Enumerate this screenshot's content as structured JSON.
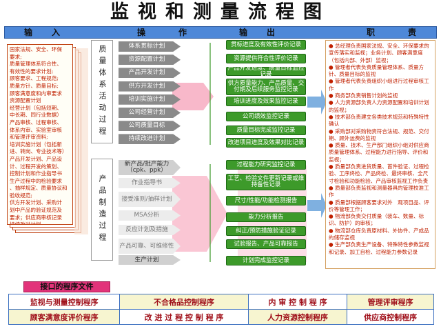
{
  "title": "监视和测量流程图",
  "headers": {
    "input": "输　入",
    "operate": "操　　作",
    "output": "输　出",
    "duty": "职　　责"
  },
  "inputs": [
    "国家法规、安全、环保",
    "要求;",
    "质量管理体系符合性、",
    "有效性的要求计划;",
    "顾客要求、工程规范;",
    "质量方针、质量目标;",
    "顾客满意度和内审要求",
    "资源配置计划",
    "经营计划（包括短期、",
    "中长期、同行业数据）",
    "产品审核、过程审核、",
    "体系内审、实验室审核",
    "和管理评审资料;",
    "培训实施计划（包括新",
    "进、转岗、专业技术等）",
    "产品开发计划、产品设",
    "计、过程开发的策划、",
    "控制计划和作业指导书",
    "生产过程中的检验要求",
    "、抽样规定、质量协议和",
    "验收规范;",
    "供方开发计划、采购计",
    "划中产品的验证规范及",
    "要求；供应商审核记录",
    "持续改进计划．"
  ],
  "stages": {
    "quality_system": "质量体系活动过程",
    "product_manufacture": "产品制造过程"
  },
  "system_processes": [
    "体系贯标计划",
    "资源配置计划",
    "产品开发计划",
    "供方开发计划",
    "培训实施计划",
    "公司经营计划",
    "公司质量目标",
    "持续改进计划"
  ],
  "system_outputs": [
    "贯标进度及有效性评价记录",
    "资源提供符合性评价记录",
    "产品开发进度、质量目标监控记录",
    "供方质量能力、产品质量、交付期及后续服务监控记录",
    "培训进度及效果监控记录",
    "公司绩效监控记录",
    "质量目标完成监控记录",
    "改进项目进度及效果对比记录"
  ],
  "manufacture_processes": [
    "新产品/批产能力（cpk、ppk）",
    "作业指导书",
    "接受准则/抽样计划",
    "MSA分析",
    "反应计划及措施",
    "产品可靠、可维修性",
    "生产计划"
  ],
  "manufacture_outputs": [
    "过程能力研究监控记录",
    "工艺、检验文件更新记录或维持备性记录",
    "尺寸/性能/功能检测报告",
    "能力分析报告",
    "纠正/预防措施验证记录",
    "试验报告、产品可靠报告",
    "计划完成监控记录"
  ],
  "duties": [
    "● 总经理负责国家法规、安全、环保要求的宣传落实和监视；业务计划、顾客满意度（包括内部、外部）监视；",
    "● 管理者代表负责质量管理体系、质量方针、质量目标的监视",
    "● 管理者代表负责组织小组进行过程审核工作",
    "● 商务部负责销售计划的监视",
    "● 人力资源部负责人力资源配置和培训计划的监视；",
    "● 技术部负责建立各类技术规范和特殊特性确认",
    "● 采购部对采购物资符合法规、规范、交付期、顾外运费的监视",
    "● 质量、技术、生产部门组织小组对供应商质量管理体系、过程能力进行指导、评价和监视；",
    "● 质量部负责进货质量、首件验证、过程检验、工序终检、产品终检、最终审核、全尺寸检验和功能检验、产品审核监视工作负责",
    "● 质量部负责监视和测量器具的管理校准工作",
    "● 质量部根据顾客要求对外　观项目品、评价等管理工作；",
    "● 物流部负责交付质量（装车、数量、标识、防护）的审核；",
    "● 物流部仓库负责原材料、外协件、产成品的储存监视",
    "● 生产部负责生产设备、特殊特性参数监视和记录、加工自检、过程能力参数记录"
  ],
  "interface": {
    "title": "接口的程序文件",
    "rows": [
      [
        "监视与测量控制程序",
        "不合格品控制程序",
        "内 审 控 制 程 序",
        "管理评审程序"
      ],
      [
        "顾客满意度评价程序",
        "改 进 过 程 控 制 程 序",
        "人力资源控制程序",
        "供应商控制程序"
      ]
    ]
  },
  "colors": {
    "header_bar": "#4e88d8",
    "output_box": "#3d9a2a",
    "process_arrow": "#8a8a8a",
    "connector_pink": "#f6a0b8",
    "interface_header": "#e2337a",
    "text_red": "#c02000"
  }
}
